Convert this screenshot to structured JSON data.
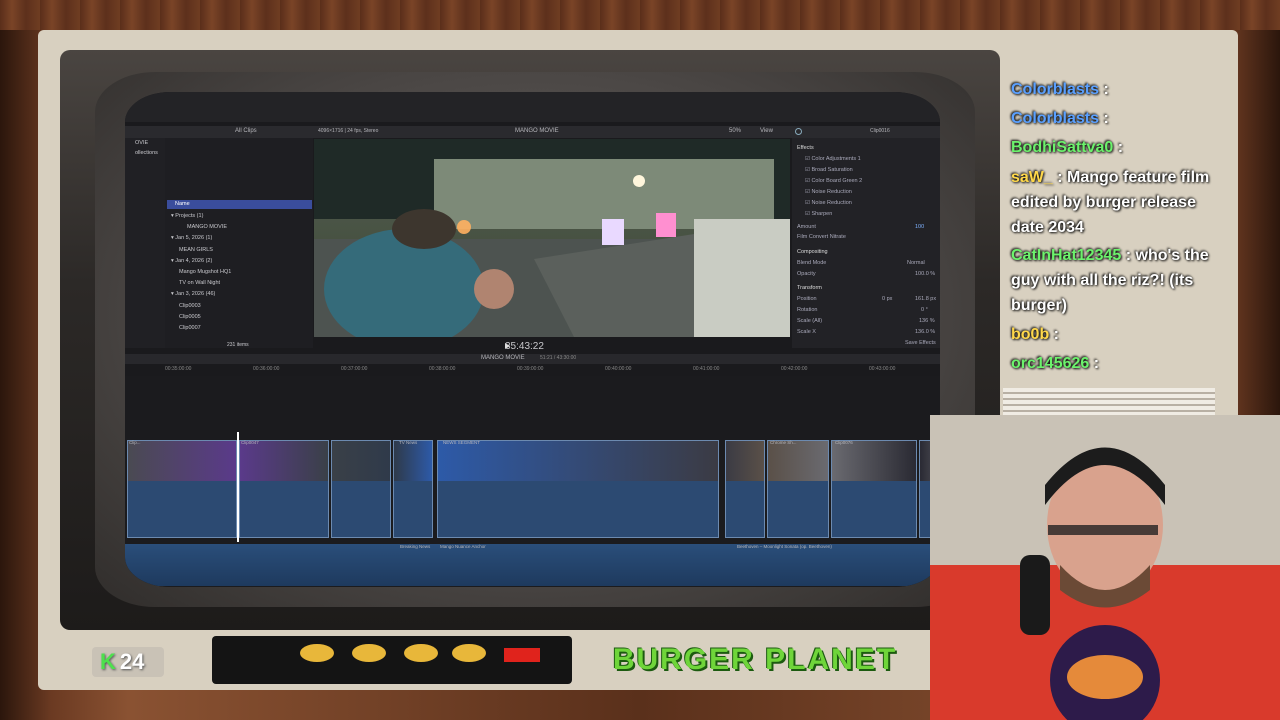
{
  "editor": {
    "browser_filter": "All Clips",
    "format_info": "4096×1716 | 24 fps, Stereo",
    "viewer_title": "MANGO MOVIE",
    "zoom": "50%",
    "view_menu": "View",
    "clip_name": "Clip0016",
    "left_tabs": [
      "OVIE",
      "ollections"
    ],
    "library": {
      "header": "Name",
      "rows": [
        {
          "label": "Projects",
          "count": "(1)",
          "indent": 0
        },
        {
          "label": "MANGO MOVIE",
          "count": "",
          "indent": 2
        },
        {
          "label": "Jan 5, 2026",
          "count": "(1)",
          "indent": 0
        },
        {
          "label": "MEAN GIRLS",
          "count": "",
          "indent": 1
        },
        {
          "label": "Jan 4, 2026",
          "count": "(2)",
          "indent": 0
        },
        {
          "label": "Mango Mugshot HQ1",
          "count": "",
          "indent": 1
        },
        {
          "label": "TV on Wall Night",
          "count": "",
          "indent": 1
        },
        {
          "label": "Jan 3, 2026",
          "count": "(46)",
          "indent": 0
        },
        {
          "label": "Clip0003",
          "count": "",
          "indent": 1
        },
        {
          "label": "Clip0005",
          "count": "",
          "indent": 1
        },
        {
          "label": "Clip0007",
          "count": "",
          "indent": 1
        }
      ],
      "item_count": "231 items"
    },
    "timecode": "35:43:22",
    "timeline_title": "MANGO MOVIE",
    "timeline_duration": "51:21 / 43:30:00",
    "inspector": {
      "section": "Effects",
      "effects": [
        "Color Adjustments 1",
        "Broad Saturation",
        "Color Board Green 2",
        "Noise Reduction",
        "Noise Reduction",
        "Sharpen"
      ],
      "amount_label": "Amount",
      "amount_value": "100",
      "film_label": "Film Convert Nitrate",
      "compositing": "Compositing",
      "blend_mode_label": "Blend Mode",
      "blend_mode_value": "Normal",
      "opacity_label": "Opacity",
      "opacity_value": "100.0 %",
      "transform": "Transform",
      "position_label": "Position",
      "position_x": "0 px",
      "position_y": "161.8 px",
      "rotation_label": "Rotation",
      "rotation_value": "0 °",
      "scale_all_label": "Scale (All)",
      "scale_all_value": "136 %",
      "scale_x_label": "Scale X",
      "scale_x_value": "136.0 %",
      "save_effects": "Save Effects"
    },
    "timeline_ticks": [
      "00:35:00:00",
      "00:36:00:00",
      "00:37:00:00",
      "00:38:00:00",
      "00:39:00:00",
      "00:40:00:00",
      "00:41:00:00",
      "00:42:00:00",
      "00:43:00:00"
    ],
    "clip_labels": [
      "Clip...",
      "Clip0047",
      "TV News",
      "NEWS SEGMENT",
      "Chrome Sh...",
      "Clip0076"
    ],
    "audio_labels": [
      "Breaking News",
      "Mango Nuance Anchor",
      "Beethoven – Moonlight Sonata (op. Beethoven)"
    ]
  },
  "chat": {
    "messages": [
      {
        "user": "Colorblasts",
        "text": "",
        "color": "#5aa0ff"
      },
      {
        "user": "Colorblasts",
        "text": "",
        "color": "#5aa0ff"
      },
      {
        "user": "BodhiSattva0",
        "text": "",
        "color": "#6cf26c"
      },
      {
        "user": "saW_",
        "text": "Mango feature film edited by burger release date 2034",
        "color": "#ffd84a"
      },
      {
        "user": "CatInHat12345",
        "text": "who's the guy with all the riz?! (its burger)",
        "color": "#6cf26c"
      },
      {
        "user": "bo0b",
        "text": "",
        "color": "#ffd84a"
      },
      {
        "user": "orc145626",
        "text": "",
        "color": "#6cf26c"
      }
    ]
  },
  "overlay": {
    "k_count": "24",
    "k_letter": "K",
    "title": "BURGER PLANET"
  }
}
